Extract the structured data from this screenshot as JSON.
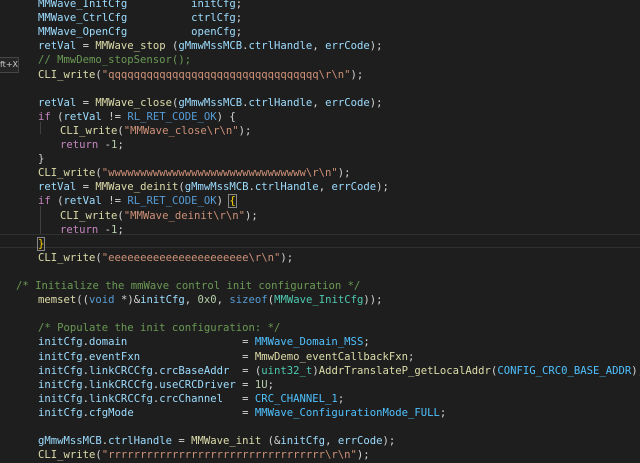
{
  "tooltip": {
    "text": "ft+X)"
  },
  "lines": [
    {
      "i": 0,
      "x": 38,
      "segs": [
        [
          "var",
          "MMWave_InitCfg"
        ],
        [
          "p",
          "          "
        ],
        [
          "var",
          "initCfg"
        ],
        [
          "p",
          ";"
        ]
      ]
    },
    {
      "i": 1,
      "x": 38,
      "segs": [
        [
          "var",
          "MMWave_CtrlCfg"
        ],
        [
          "p",
          "          "
        ],
        [
          "var",
          "ctrlCfg"
        ],
        [
          "p",
          ";"
        ]
      ]
    },
    {
      "i": 2,
      "x": 38,
      "segs": [
        [
          "var",
          "MMWave_OpenCfg"
        ],
        [
          "p",
          "          "
        ],
        [
          "var",
          "openCfg"
        ],
        [
          "p",
          ";"
        ]
      ]
    },
    {
      "i": 3,
      "x": 38,
      "segs": [
        [
          "var",
          "retVal"
        ],
        [
          "p",
          " = "
        ],
        [
          "fn",
          "MMWave_stop"
        ],
        [
          "p",
          " ("
        ],
        [
          "var",
          "gMmwMssMCB"
        ],
        [
          "p",
          "."
        ],
        [
          "var",
          "ctrlHandle"
        ],
        [
          "p",
          ", "
        ],
        [
          "var",
          "errCode"
        ],
        [
          "p",
          ");"
        ]
      ]
    },
    {
      "i": 4,
      "x": 38,
      "segs": [
        [
          "cmt",
          "// MmwDemo_stopSensor();"
        ]
      ]
    },
    {
      "i": 5,
      "x": 38,
      "segs": [
        [
          "fn",
          "CLI_write"
        ],
        [
          "p",
          "("
        ],
        [
          "str",
          "\"qqqqqqqqqqqqqqqqqqqqqqqqqqqqqqqqq\\r\\n\""
        ],
        [
          "p",
          ");"
        ]
      ]
    },
    {
      "i": 6,
      "x": 38,
      "segs": []
    },
    {
      "i": 7,
      "x": 38,
      "segs": [
        [
          "var",
          "retVal"
        ],
        [
          "p",
          " = "
        ],
        [
          "fn",
          "MMWave_close"
        ],
        [
          "p",
          "("
        ],
        [
          "var",
          "gMmwMssMCB"
        ],
        [
          "p",
          "."
        ],
        [
          "var",
          "ctrlHandle"
        ],
        [
          "p",
          ", "
        ],
        [
          "var",
          "errCode"
        ],
        [
          "p",
          ");"
        ]
      ]
    },
    {
      "i": 8,
      "x": 38,
      "segs": [
        [
          "kw",
          "if"
        ],
        [
          "p",
          " ("
        ],
        [
          "var",
          "retVal"
        ],
        [
          "p",
          " != "
        ],
        [
          "kwb",
          "RL_RET_CODE_OK"
        ],
        [
          "p",
          ") {"
        ]
      ]
    },
    {
      "i": 9,
      "x": 60,
      "segs": [
        [
          "fn",
          "CLI_write"
        ],
        [
          "p",
          "("
        ],
        [
          "str",
          "\"MMWave_close\\r\\n\""
        ],
        [
          "p",
          ");"
        ]
      ]
    },
    {
      "i": 10,
      "x": 60,
      "segs": [
        [
          "kw",
          "return"
        ],
        [
          "p",
          " -"
        ],
        [
          "num",
          "1"
        ],
        [
          "p",
          ";"
        ]
      ]
    },
    {
      "i": 11,
      "x": 38,
      "segs": [
        [
          "p",
          "}"
        ]
      ]
    },
    {
      "i": 12,
      "x": 38,
      "segs": [
        [
          "fn",
          "CLI_write"
        ],
        [
          "p",
          "("
        ],
        [
          "str",
          "\"wwwwwwwwwwwwwwwwwwwwwwwwwwwwwww\\r\\n\""
        ],
        [
          "p",
          ");"
        ]
      ]
    },
    {
      "i": 13,
      "x": 38,
      "segs": [
        [
          "var",
          "retVal"
        ],
        [
          "p",
          " = "
        ],
        [
          "fn",
          "MMWave_deinit"
        ],
        [
          "p",
          "("
        ],
        [
          "var",
          "gMmwMssMCB"
        ],
        [
          "p",
          "."
        ],
        [
          "var",
          "ctrlHandle"
        ],
        [
          "p",
          ", "
        ],
        [
          "var",
          "errCode"
        ],
        [
          "p",
          ");"
        ]
      ]
    },
    {
      "i": 14,
      "x": 38,
      "segs": [
        [
          "kw",
          "if"
        ],
        [
          "p",
          " ("
        ],
        [
          "var",
          "retVal"
        ],
        [
          "p",
          " != "
        ],
        [
          "kwb",
          "RL_RET_CODE_OK"
        ],
        [
          "p",
          ") "
        ],
        [
          "br",
          "{"
        ]
      ]
    },
    {
      "i": 15,
      "x": 60,
      "segs": [
        [
          "fn",
          "CLI_write"
        ],
        [
          "p",
          "("
        ],
        [
          "str",
          "\"MMWave_deinit\\r\\n\""
        ],
        [
          "p",
          ");"
        ]
      ]
    },
    {
      "i": 16,
      "x": 60,
      "segs": [
        [
          "kw",
          "return"
        ],
        [
          "p",
          " -"
        ],
        [
          "num",
          "1"
        ],
        [
          "p",
          ";"
        ]
      ]
    },
    {
      "i": 17,
      "x": 38,
      "segs": [
        [
          "br",
          "}"
        ]
      ]
    },
    {
      "i": 18,
      "x": 38,
      "segs": [
        [
          "fn",
          "CLI_write"
        ],
        [
          "p",
          "("
        ],
        [
          "str",
          "\"eeeeeeeeeeeeeeeeeeeeee\\r\\n\""
        ],
        [
          "p",
          ");"
        ]
      ]
    },
    {
      "i": 19,
      "x": 38,
      "segs": []
    },
    {
      "i": 20,
      "x": 16,
      "segs": [
        [
          "cmt",
          "/* Initialize the mmWave control init configuration */"
        ]
      ]
    },
    {
      "i": 21,
      "x": 38,
      "segs": [
        [
          "fn",
          "memset"
        ],
        [
          "p",
          "(("
        ],
        [
          "kwb",
          "void"
        ],
        [
          "p",
          " *)&"
        ],
        [
          "var",
          "initCfg"
        ],
        [
          "p",
          ", "
        ],
        [
          "num",
          "0x0"
        ],
        [
          "p",
          ", "
        ],
        [
          "kwb",
          "sizeof"
        ],
        [
          "p",
          "("
        ],
        [
          "ty",
          "MMWave_InitCfg"
        ],
        [
          "p",
          "));"
        ]
      ]
    },
    {
      "i": 22,
      "x": 38,
      "segs": []
    },
    {
      "i": 23,
      "x": 38,
      "segs": [
        [
          "cmt",
          "/* Populate the init configuration: */"
        ]
      ]
    },
    {
      "i": 24,
      "x": 38,
      "segs": [
        [
          "var",
          "initCfg"
        ],
        [
          "p",
          "."
        ],
        [
          "var",
          "domain"
        ],
        [
          "p",
          "                  = "
        ],
        [
          "const",
          "MMWave_Domain_MSS"
        ],
        [
          "p",
          ";"
        ]
      ]
    },
    {
      "i": 25,
      "x": 38,
      "segs": [
        [
          "var",
          "initCfg"
        ],
        [
          "p",
          "."
        ],
        [
          "var",
          "eventFxn"
        ],
        [
          "p",
          "                = "
        ],
        [
          "fn",
          "MmwDemo_eventCallbackFxn"
        ],
        [
          "p",
          ";"
        ]
      ]
    },
    {
      "i": 26,
      "x": 38,
      "segs": [
        [
          "var",
          "initCfg"
        ],
        [
          "p",
          "."
        ],
        [
          "var",
          "linkCRCCfg"
        ],
        [
          "p",
          "."
        ],
        [
          "var",
          "crcBaseAddr"
        ],
        [
          "p",
          "  = ("
        ],
        [
          "ty",
          "uint32_t"
        ],
        [
          "p",
          ")"
        ],
        [
          "fn",
          "AddrTranslateP_getLocalAddr"
        ],
        [
          "p",
          "("
        ],
        [
          "const",
          "CONFIG_CRC0_BASE_ADDR"
        ],
        [
          "p",
          ");"
        ]
      ]
    },
    {
      "i": 27,
      "x": 38,
      "segs": [
        [
          "var",
          "initCfg"
        ],
        [
          "p",
          "."
        ],
        [
          "var",
          "linkCRCCfg"
        ],
        [
          "p",
          "."
        ],
        [
          "var",
          "useCRCDriver"
        ],
        [
          "p",
          " = "
        ],
        [
          "num",
          "1U"
        ],
        [
          "p",
          ";"
        ]
      ]
    },
    {
      "i": 28,
      "x": 38,
      "segs": [
        [
          "var",
          "initCfg"
        ],
        [
          "p",
          "."
        ],
        [
          "var",
          "linkCRCCfg"
        ],
        [
          "p",
          "."
        ],
        [
          "var",
          "crcChannel"
        ],
        [
          "p",
          "   = "
        ],
        [
          "const",
          "CRC_CHANNEL_1"
        ],
        [
          "p",
          ";"
        ]
      ]
    },
    {
      "i": 29,
      "x": 38,
      "segs": [
        [
          "var",
          "initCfg"
        ],
        [
          "p",
          "."
        ],
        [
          "var",
          "cfgMode"
        ],
        [
          "p",
          "                 = "
        ],
        [
          "const",
          "MMWave_ConfigurationMode_FULL"
        ],
        [
          "p",
          ";"
        ]
      ]
    },
    {
      "i": 30,
      "x": 38,
      "segs": []
    },
    {
      "i": 31,
      "x": 38,
      "segs": [
        [
          "var",
          "gMmwMssMCB"
        ],
        [
          "p",
          "."
        ],
        [
          "var",
          "ctrlHandle"
        ],
        [
          "p",
          " = "
        ],
        [
          "fn",
          "MMWave_init"
        ],
        [
          "p",
          " (&"
        ],
        [
          "var",
          "initCfg"
        ],
        [
          "p",
          ", "
        ],
        [
          "var",
          "errCode"
        ],
        [
          "p",
          ");"
        ]
      ]
    },
    {
      "i": 32,
      "x": 38,
      "segs": [
        [
          "fn",
          "CLI_write"
        ],
        [
          "p",
          "("
        ],
        [
          "str",
          "\"rrrrrrrrrrrrrrrrrrrrrrrrrrrrrrrrrr\\r\\n\""
        ],
        [
          "p",
          ");"
        ]
      ]
    }
  ]
}
